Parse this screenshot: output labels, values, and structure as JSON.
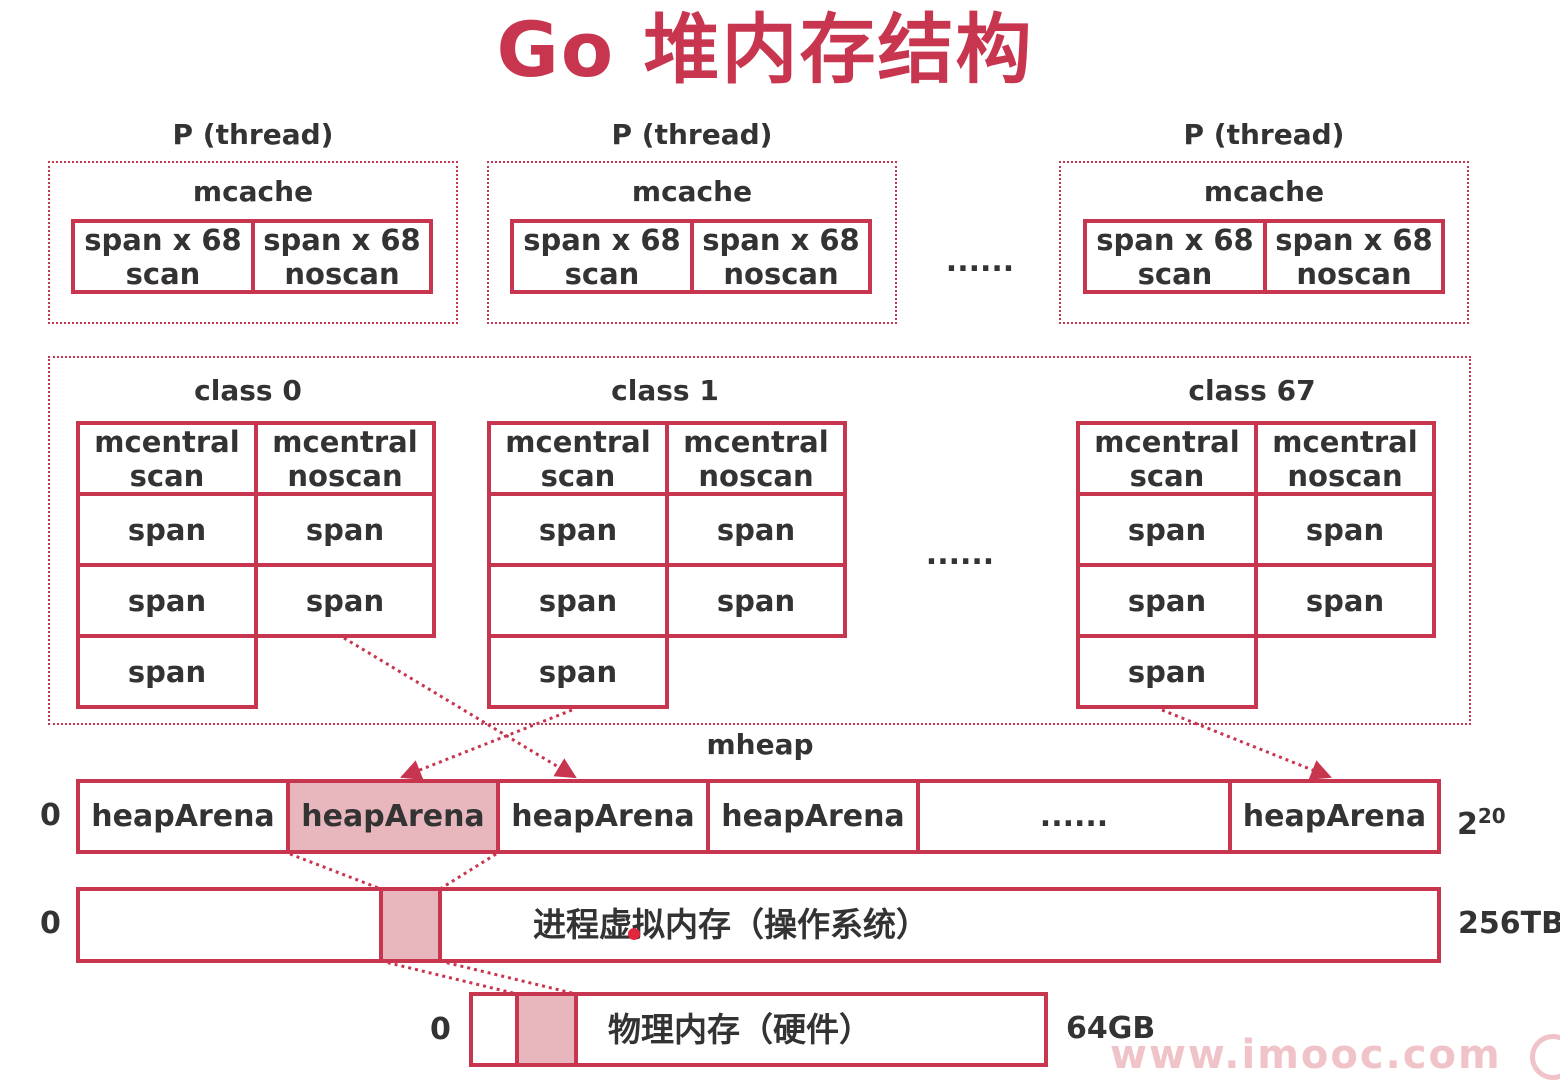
{
  "title": "Go 堆内存结构",
  "threads": [
    {
      "label": "P (thread)",
      "cache": "mcache",
      "spans": [
        [
          "span x 68",
          "scan"
        ],
        [
          "span x 68",
          "noscan"
        ]
      ]
    },
    {
      "label": "P (thread)",
      "cache": "mcache",
      "spans": [
        [
          "span x 68",
          "scan"
        ],
        [
          "span x 68",
          "noscan"
        ]
      ]
    },
    {
      "label": "P (thread)",
      "cache": "mcache",
      "spans": [
        [
          "span x 68",
          "scan"
        ],
        [
          "span x 68",
          "noscan"
        ]
      ]
    }
  ],
  "thread_ellipsis": "......",
  "classes": [
    {
      "label": "class 0",
      "heads": [
        [
          "mcentral",
          "scan"
        ],
        [
          "mcentral",
          "noscan"
        ]
      ],
      "span": "span"
    },
    {
      "label": "class 1",
      "heads": [
        [
          "mcentral",
          "scan"
        ],
        [
          "mcentral",
          "noscan"
        ]
      ],
      "span": "span"
    },
    {
      "label": "class 67",
      "heads": [
        [
          "mcentral",
          "scan"
        ],
        [
          "mcentral",
          "noscan"
        ]
      ],
      "span": "span"
    }
  ],
  "class_ellipsis": "......",
  "mheap": {
    "label": "mheap",
    "start": "0",
    "arenas": [
      "heapArena",
      "heapArena",
      "heapArena",
      "heapArena",
      "......",
      "heapArena"
    ],
    "end_base": "2",
    "end_exp": "20"
  },
  "virtual": {
    "start": "0",
    "label": "进程虚拟内存（操作系统）",
    "end": "256TB"
  },
  "physical": {
    "start": "0",
    "label": "物理内存（硬件）",
    "end": "64GB"
  },
  "watermark": "www.imooc.com",
  "colors": {
    "accent": "#c8354f",
    "shade": "#e8b7bd"
  }
}
